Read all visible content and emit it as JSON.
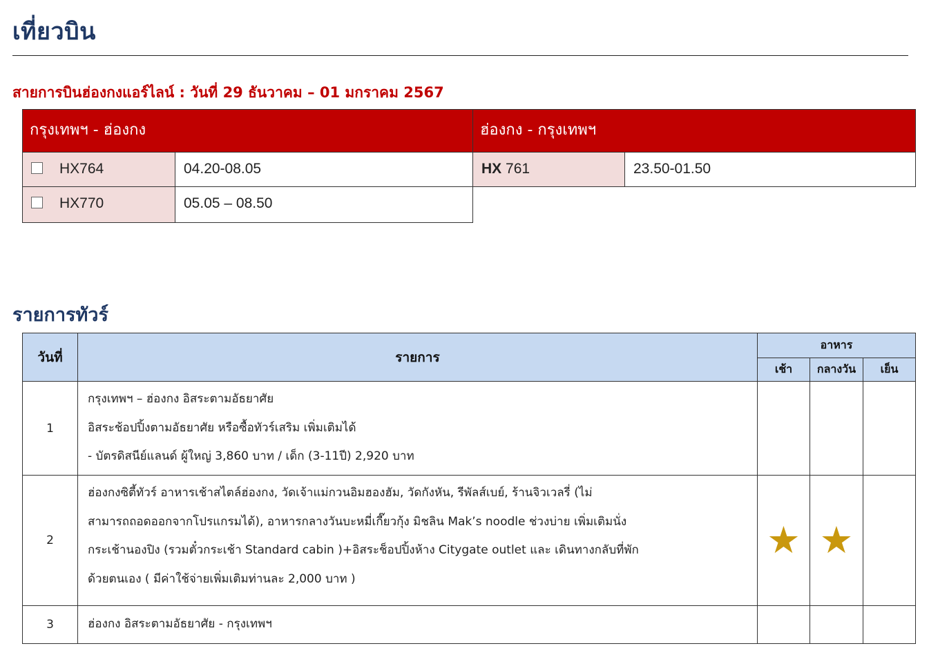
{
  "page": {
    "title": "เที่ยวบิน"
  },
  "flights": {
    "heading": "สายการบินฮ่องกงแอร์ไลน์ : วันที่ 29 ธันวาคม – 01 มกราคม 2567",
    "outbound": {
      "route": "กรุงเทพฯ - ฮ่องกง",
      "rows": [
        {
          "flight": "HX764",
          "time": "04.20-08.05",
          "checked": false
        },
        {
          "flight": "HX770",
          "time": "05.05 – 08.50",
          "checked": false
        }
      ]
    },
    "return": {
      "route": "ฮ่องกง - กรุงเทพฯ",
      "rows": [
        {
          "flight_code": "HX",
          "flight_number": " 761",
          "time": "23.50-01.50"
        }
      ]
    }
  },
  "tour": {
    "heading": "รายการทัวร์",
    "headers": {
      "day": "วันที่",
      "items": "รายการ",
      "meals": "อาหาร",
      "breakfast": "เช้า",
      "lunch": "กลางวัน",
      "dinner": "เย็น"
    },
    "days": [
      {
        "day": "1",
        "lines": [
          "กรุงเทพฯ – ฮ่องกง  อิสระตามอัธยาศัย",
          "อิสระช้อปปิ้งตามอัธยาศัย หรือซื้อทัวร์เสริม เพิ่มเติมได้",
          "- บัตรดิสนีย์แลนด์   ผู้ใหญ่ 3,860 บาท / เด็ก (3-11ปี)  2,920 บาท"
        ],
        "meals": {
          "breakfast": "",
          "lunch": "",
          "dinner": ""
        }
      },
      {
        "day": "2",
        "lines": [
          "ฮ่องกงซิตี้ทัวร์ อาหารเช้าสไตล์ฮ่องกง, วัดเจ้าแม่กวนอิมฮองฮัม, วัดกังหัน, รีพัลส์เบย์, ร้านจิวเวลรี่ (ไม่",
          "สามารถถอดออกจากโปรแกรมได้), อาหารกลางวันบะหมี่เกี๊ยวกุ้ง มิชลิน Mak’s noodle ช่วงบ่าย เพิ่มเติมนั่ง",
          "กระเช้านองปิง (รวมตั๋วกระเช้า Standard cabin )+อิสระช็อปปิ้งห้าง Citygate outlet และ เดินทางกลับที่พัก",
          "ด้วยตนเอง  ( มีค่าใช้จ่ายเพิ่มเติมท่านละ 2,000 บาท )"
        ],
        "meals": {
          "breakfast": "★",
          "lunch": "★",
          "dinner": ""
        }
      },
      {
        "day": "3",
        "lines": [
          "ฮ่องกง อิสระตามอัธยาศัย - กรุงเทพฯ"
        ],
        "meals": {
          "breakfast": "",
          "lunch": "",
          "dinner": ""
        }
      }
    ],
    "star_color": "#c9980e"
  }
}
